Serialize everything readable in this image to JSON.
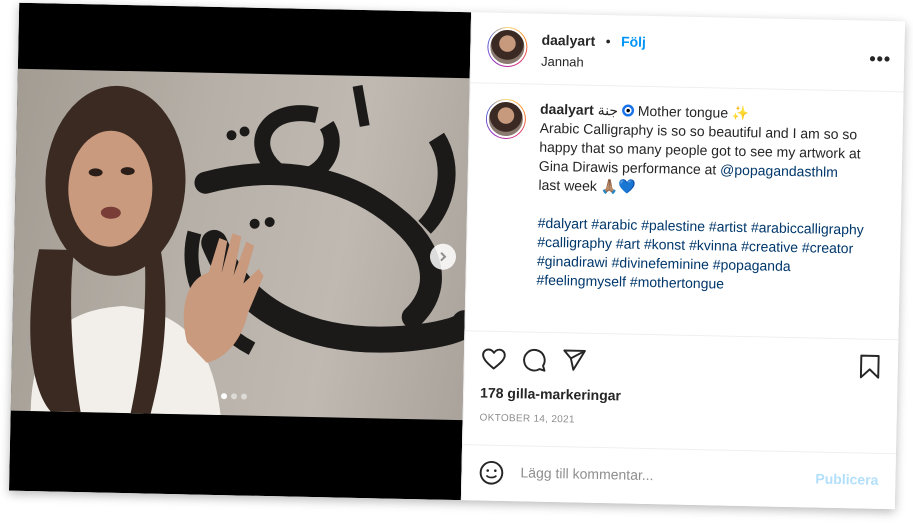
{
  "header": {
    "username": "daalyart",
    "separator": "•",
    "follow_label": "Följ",
    "location": "Jannah",
    "more_icon": "more-horizontal-icon"
  },
  "caption": {
    "username": "daalyart",
    "arabic": "جنة",
    "title_text": "Mother tongue",
    "sparkle": "✨",
    "body1": "Arabic Calligraphy is so so beautiful and I am so so happy that so many people got to see my artwork at Gina Dirawis performance at",
    "mention": "@popagandasthlm",
    "body2": "last week",
    "emoji_end": "🙏🏽💙",
    "hashtags": [
      "#dalyart",
      "#arabic",
      "#palestine",
      "#artist",
      "#arabiccalligraphy",
      "#calligraphy",
      "#art",
      "#konst",
      "#kvinna",
      "#creative",
      "#creator",
      "#ginadirawi",
      "#divinefeminine",
      "#popaganda",
      "#feelingmyself",
      "#mothertongue"
    ]
  },
  "actions": {
    "icons": [
      "heart-icon",
      "comment-icon",
      "share-icon",
      "bookmark-icon"
    ]
  },
  "likes_text": "178 gilla-markeringar",
  "date_text": "OKTOBER 14, 2021",
  "comment": {
    "placeholder": "Lägg till kommentar...",
    "publish_label": "Publicera"
  },
  "media": {
    "carousel_total": 3,
    "carousel_active": 1
  },
  "colors": {
    "link": "#00376b",
    "follow": "#0095f6",
    "publish_disabled": "#b2dffc"
  }
}
